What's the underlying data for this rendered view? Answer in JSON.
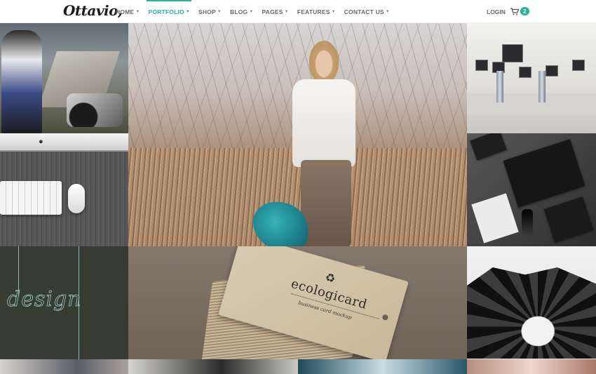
{
  "brand": {
    "logo": "Ottavio,"
  },
  "nav": {
    "items": [
      {
        "label": "HOME",
        "active": false
      },
      {
        "label": "PORTFOLIO",
        "active": true
      },
      {
        "label": "SHOP",
        "active": false
      },
      {
        "label": "BLOG",
        "active": false
      },
      {
        "label": "PAGES",
        "active": false
      },
      {
        "label": "FEATURES",
        "active": false
      },
      {
        "label": "CONTACT US",
        "active": false
      }
    ],
    "login": "LOGIN",
    "cart_count": "2"
  },
  "colors": {
    "accent": "#27b39a",
    "nav_text": "#6a6a6a"
  },
  "portfolio": {
    "design_tile_text": "design",
    "card_brand": "ecologicard",
    "card_subtitle": "business card mockup"
  },
  "icons": {
    "cart": "shopping-cart-icon",
    "caret": "caret-down-icon",
    "recycle": "recycle-icon",
    "apple": "apple-logo-icon"
  }
}
